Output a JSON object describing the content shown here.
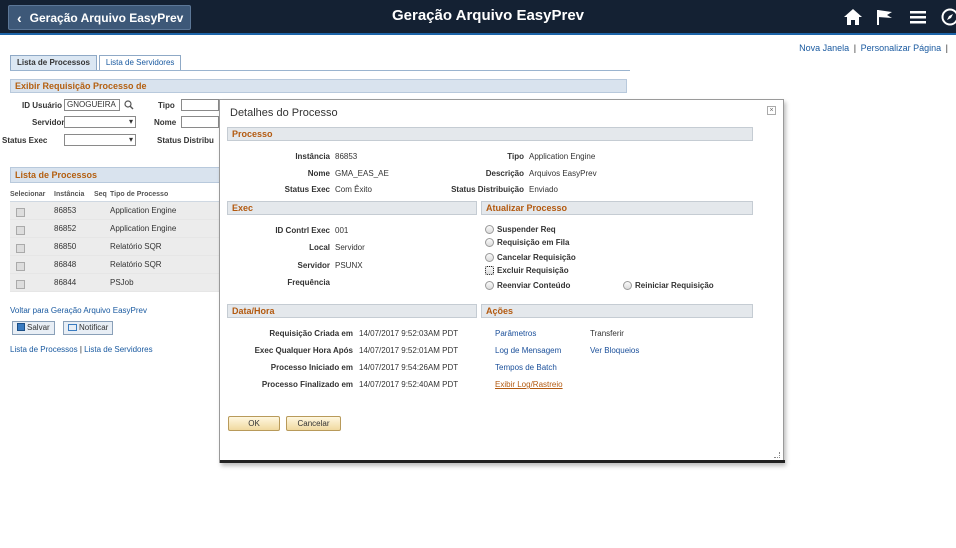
{
  "banner": {
    "back_label": "Geração Arquivo EasyPrev",
    "title": "Geração Arquivo EasyPrev"
  },
  "top_links": {
    "nova_janela": "Nova Janela",
    "sep": "|",
    "personalizar": "Personalizar Página",
    "sep2": "|"
  },
  "tabs": [
    {
      "label": "Lista de Processos"
    },
    {
      "label": "Lista de Servidores"
    }
  ],
  "form": {
    "section_title": "Exibir Requisição Processo de",
    "id_usuario_label": "ID Usuário",
    "id_usuario_value": "GNOGUEIRA",
    "tipo_label": "Tipo",
    "servidor_label": "Servidor",
    "nome_label": "Nome",
    "status_exec_label": "Status Exec",
    "status_distrib_label": "Status Distribu"
  },
  "process_list": {
    "title": "Lista de Processos",
    "headers": [
      "Selecionar",
      "Instância",
      "Seq",
      "Tipo de Processo"
    ],
    "rows": [
      {
        "instancia": "86853",
        "tipo": "Application Engine"
      },
      {
        "instancia": "86852",
        "tipo": "Application Engine"
      },
      {
        "instancia": "86850",
        "tipo": "Relatório SQR"
      },
      {
        "instancia": "86848",
        "tipo": "Relatório SQR"
      },
      {
        "instancia": "86844",
        "tipo": "PSJob"
      }
    ]
  },
  "footer": {
    "voltar": "Voltar para Geração Arquivo EasyPrev",
    "salvar": "Salvar",
    "notificar": "Notificar",
    "lista_processos": "Lista de Processos",
    "sep": "|",
    "lista_servidores": "Lista de Servidores"
  },
  "modal": {
    "title": "Detalhes do Processo",
    "close": "×",
    "processo": {
      "header": "Processo",
      "instancia_label": "Instância",
      "instancia_value": "86853",
      "nome_label": "Nome",
      "nome_value": "GMA_EAS_AE",
      "status_exec_label": "Status Exec",
      "status_exec_value": "Com Êxito",
      "tipo_label": "Tipo",
      "tipo_value": "Application Engine",
      "descricao_label": "Descrição",
      "descricao_value": "Arquivos EasyPrev",
      "status_distrib_label": "Status Distribuição",
      "status_distrib_value": "Enviado"
    },
    "exec": {
      "header": "Exec",
      "id_contrl_label": "ID Contrl Exec",
      "id_contrl_value": "001",
      "local_label": "Local",
      "local_value": "Servidor",
      "servidor_label": "Servidor",
      "servidor_value": "PSUNX",
      "frequencia_label": "Frequência"
    },
    "atualizar": {
      "header": "Atualizar Processo",
      "suspender": "Suspender Req",
      "requisicao_fila": "Requisição em Fila",
      "cancelar": "Cancelar Requisição",
      "excluir": "Excluir Requisição",
      "reenviar": "Reenviar Conteúdo",
      "reiniciar": "Reiniciar Requisição"
    },
    "datahora": {
      "header": "Data/Hora",
      "criada_label": "Requisição Criada em",
      "criada_value": "14/07/2017  9:52:03AM PDT",
      "qualquer_label": "Exec Qualquer Hora Após",
      "qualquer_value": "14/07/2017  9:52:01AM PDT",
      "iniciado_label": "Processo Iniciado em",
      "iniciado_value": "14/07/2017  9:54:26AM PDT",
      "finalizado_label": "Processo Finalizado em",
      "finalizado_value": "14/07/2017  9:52:40AM PDT"
    },
    "acoes": {
      "header": "Ações",
      "parametros": "Parâmetros",
      "transferir": "Transferir",
      "log_mensagem": "Log de Mensagem",
      "ver_bloqueios": "Ver Bloqueios",
      "tempos_batch": "Tempos de Batch",
      "exibir_log": "Exibir Log/Rastreio"
    },
    "buttons": {
      "ok": "OK",
      "cancelar": "Cancelar"
    }
  }
}
